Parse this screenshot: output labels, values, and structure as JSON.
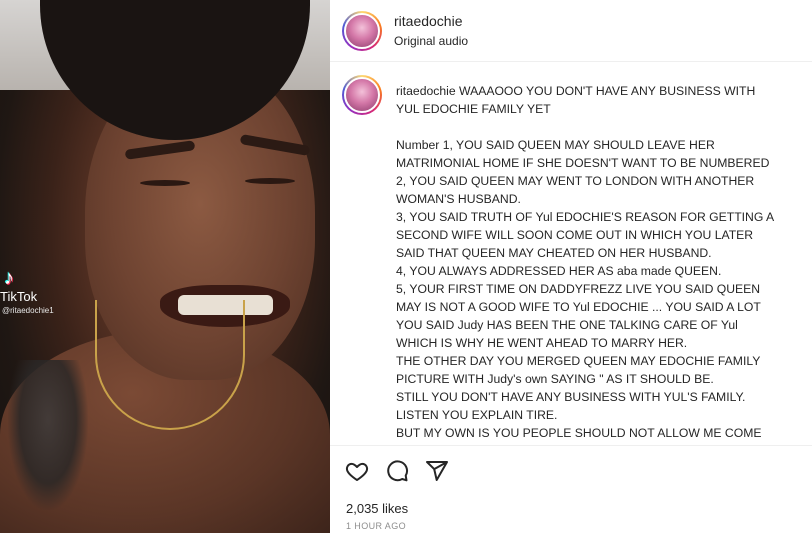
{
  "post": {
    "username": "ritaedochie",
    "audio": "Original audio"
  },
  "video": {
    "watermark_brand": "TikTok",
    "watermark_user": "@ritaedochie1"
  },
  "caption": {
    "username": "ritaedochie",
    "lines": [
      "WAAAOOO YOU DON'T HAVE ANY BUSINESS WITH",
      "YUL EDOCHIE FAMILY YET",
      "",
      "Number 1, YOU SAID QUEEN MAY SHOULD LEAVE HER",
      "MATRIMONIAL HOME IF SHE DOESN'T WANT TO BE NUMBERED",
      "2, YOU SAID QUEEN MAY WENT TO LONDON WITH ANOTHER",
      "WOMAN'S HUSBAND.",
      "3, YOU SAID TRUTH OF Yul EDOCHIE'S REASON FOR GETTING A",
      "SECOND WIFE WILL SOON COME OUT IN WHICH YOU LATER",
      "SAID THAT QUEEN MAY CHEATED ON HER HUSBAND.",
      "4, YOU ALWAYS ADDRESSED HER AS aba made QUEEN.",
      "5, YOUR FIRST TIME ON DADDYFREZZ LIVE YOU SAID QUEEN",
      "MAY IS NOT A GOOD WIFE TO Yul EDOCHIE ... YOU SAID A LOT",
      "YOU SAID Judy HAS BEEN THE ONE TALKING CARE OF Yul",
      "WHICH IS WHY HE WENT AHEAD TO MARRY HER.",
      "THE OTHER DAY YOU MERGED QUEEN MAY EDOCHIE FAMILY",
      "PICTURE WITH Judy's own SAYING \" AS IT SHOULD BE.",
      "STILL YOU DON'T HAVE ANY BUSINESS WITH YUL'S FAMILY.",
      "LISTEN YOU EXPLAIN TIRE.",
      "BUT MY OWN IS YOU PEOPLE SHOULD NOT ALLOW ME COME"
    ]
  },
  "actions": {
    "icons": [
      "heart-icon",
      "comment-icon",
      "share-icon"
    ],
    "likes": "2,035 likes",
    "time": "1 HOUR AGO"
  }
}
